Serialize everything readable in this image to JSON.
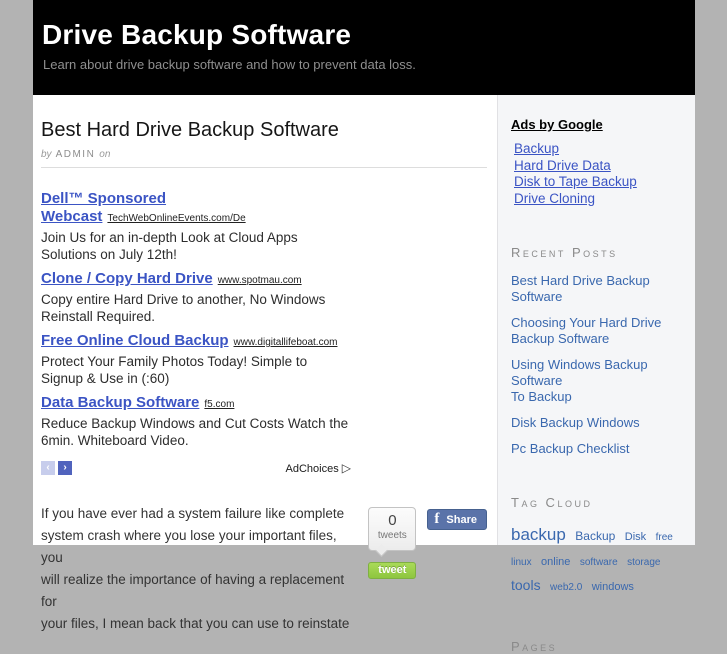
{
  "header": {
    "title": "Drive Backup Software",
    "subtitle": "Learn about drive backup software and how to prevent data loss."
  },
  "main": {
    "post_title": "Best Hard Drive Backup Software",
    "byline": {
      "by": "by",
      "author": "ADMIN",
      "on": "on"
    },
    "ads": [
      {
        "title": "Dell™ Sponsored Webcast",
        "domain": "TechWebOnlineEvents.com/De",
        "description": "Join Us for an in-depth Look at Cloud Apps\nSolutions on July 12th!"
      },
      {
        "title": "Clone / Copy Hard Drive",
        "domain": "www.spotmau.com",
        "description": "Copy entire Hard Drive to another, No Windows\nReinstall Required."
      },
      {
        "title": "Free Online Cloud Backup",
        "domain": "www.digitallifeboat.com",
        "description": "Protect Your Family Photos Today! Simple to\nSignup & Use in (:60)"
      },
      {
        "title": "Data Backup Software",
        "domain": "f5.com",
        "description": "Reduce Backup Windows and Cut Costs Watch the\n6min. Whiteboard Video."
      }
    ],
    "ad_nav": {
      "prev": "‹",
      "next": "›"
    },
    "adchoices_label": "AdChoices",
    "adchoices_icon": "▷",
    "paragraph": "If you have ever had a system failure like complete\nsystem crash where you lose your important files, you\nwill realize the importance of having a replacement for\nyour files, I mean back that you can use to reinstate",
    "tweet_widget": {
      "count": "0",
      "count_label": "tweets",
      "button_label": "tweet"
    },
    "share_widget": {
      "f": "f",
      "label": "Share"
    }
  },
  "sidebar": {
    "ads_heading": "Ads by Google",
    "ad_links": [
      {
        "label": "Backup"
      },
      {
        "label": "Hard Drive Data"
      },
      {
        "label": "Disk to Tape Backup"
      },
      {
        "label": "Drive Cloning"
      }
    ],
    "recent_posts_heading": "Recent Posts",
    "recent_posts": [
      {
        "label": "Best Hard Drive Backup Software"
      },
      {
        "label": "Choosing Your Hard Drive\nBackup Software"
      },
      {
        "label": "Using Windows Backup Software\nTo Backup"
      },
      {
        "label": "Disk Backup Windows"
      },
      {
        "label": "Pc Backup Checklist"
      }
    ],
    "tag_cloud_heading": "Tag Cloud",
    "tags": [
      {
        "label": "backup",
        "size": 17
      },
      {
        "label": "Backup",
        "size": 12
      },
      {
        "label": "Disk",
        "size": 11
      },
      {
        "label": "free",
        "size": 10
      },
      {
        "label": "linux",
        "size": 10
      },
      {
        "label": "online",
        "size": 11
      },
      {
        "label": "software",
        "size": 10
      },
      {
        "label": "storage",
        "size": 10
      },
      {
        "label": "tools",
        "size": 14
      },
      {
        "label": "web2.0",
        "size": 10
      },
      {
        "label": "windows",
        "size": 11
      }
    ],
    "pages_heading": "Pages"
  },
  "colors": {
    "page_background": "#b3b3b3",
    "header_background": "#000000",
    "adsense_link_blue": "#3b54c4",
    "sidebar_link_blue": "#3a68ae",
    "tweet_button_green": "#8ec63f",
    "facebook_blue": "#5a73a9",
    "sidebar_background": "#f5f6f8"
  }
}
